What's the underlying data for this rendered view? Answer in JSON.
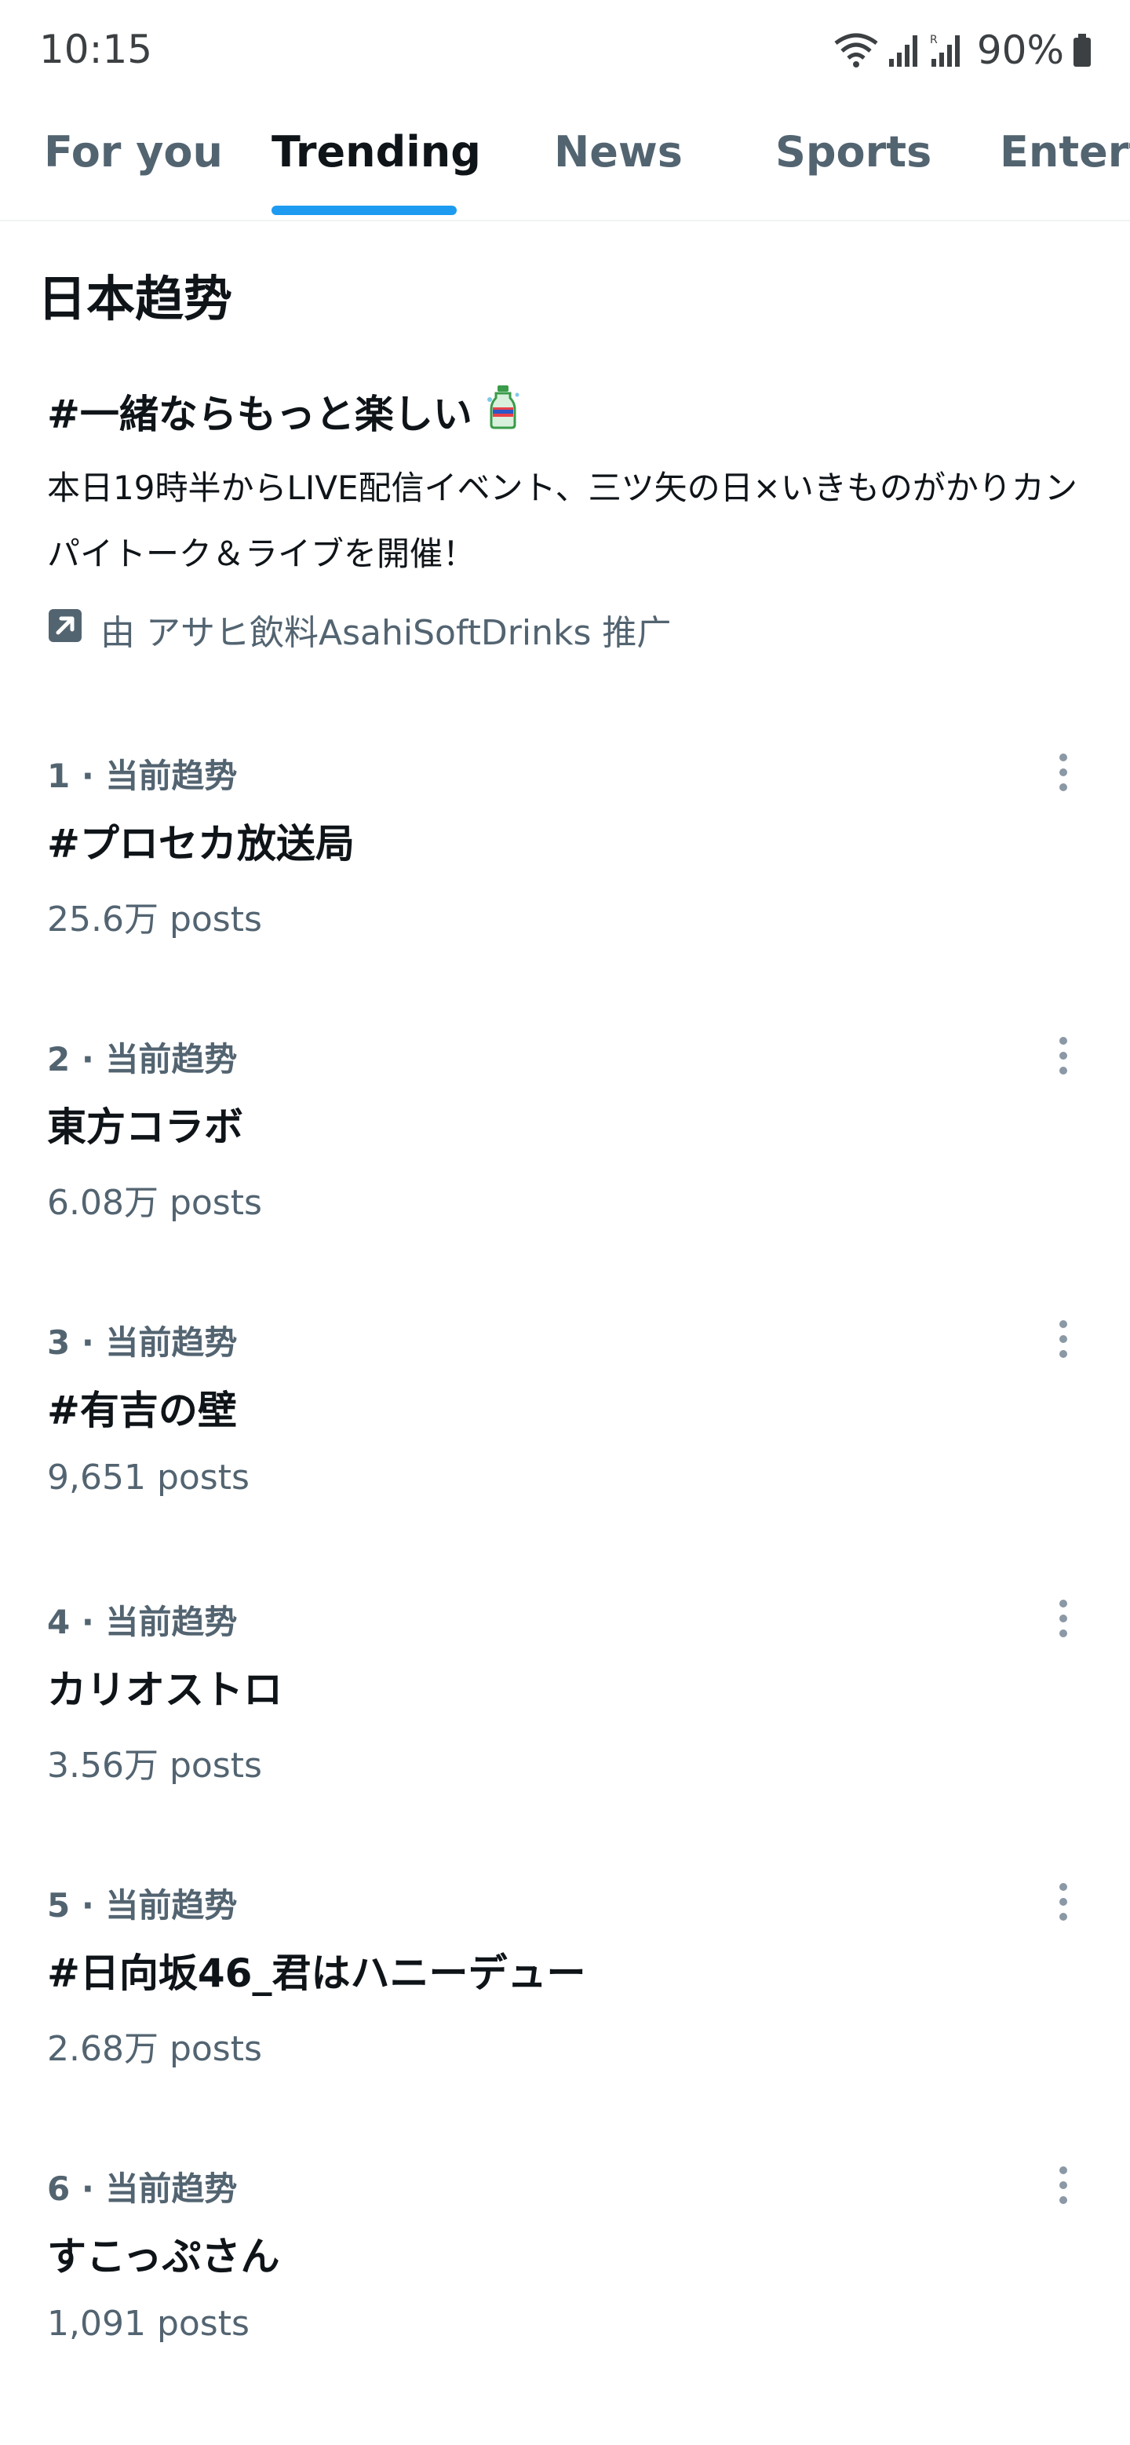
{
  "status_bar": {
    "time": "10:15",
    "battery": "90%",
    "icons": [
      "wifi-icon",
      "signal-icon",
      "signal-r-icon",
      "battery-icon"
    ]
  },
  "tabs": [
    {
      "label": "For you",
      "active": false
    },
    {
      "label": "Trending",
      "active": true
    },
    {
      "label": "News",
      "active": false
    },
    {
      "label": "Sports",
      "active": false
    },
    {
      "label": "Entert",
      "active": false
    }
  ],
  "section_title": "日本趋势",
  "promoted": {
    "title": "#一緒ならもっと楽しい",
    "description": "本日19時半からLIVE配信イベント、三ツ矢の日×いきものがかりカンパイトーク＆ライブを開催！",
    "by_line": "由 アサヒ飲料AsahiSoftDrinks 推广",
    "icons": [
      "bottle-emoji-icon",
      "promoted-arrow-icon"
    ]
  },
  "trends": [
    {
      "meta": "1 · 当前趋势",
      "name": "#プロセカ放送局",
      "count": "25.6万 posts"
    },
    {
      "meta": "2 · 当前趋势",
      "name": "東方コラボ",
      "count": "6.08万 posts"
    },
    {
      "meta": "3 · 当前趋势",
      "name": "#有吉の壁",
      "count": "9,651 posts"
    },
    {
      "meta": "4 · 当前趋势",
      "name": "カリオストロ",
      "count": "3.56万 posts"
    },
    {
      "meta": "5 · 当前趋势",
      "name": "#日向坂46_君はハニーデュー",
      "count": "2.68万 posts"
    },
    {
      "meta": "6 · 当前趋势",
      "name": "すこっぷさん",
      "count": "1,091 posts"
    }
  ],
  "colors": {
    "accent": "#1d9bf0",
    "text_primary": "#0f1419",
    "text_secondary": "#536471",
    "divider": "#eff3f4"
  }
}
